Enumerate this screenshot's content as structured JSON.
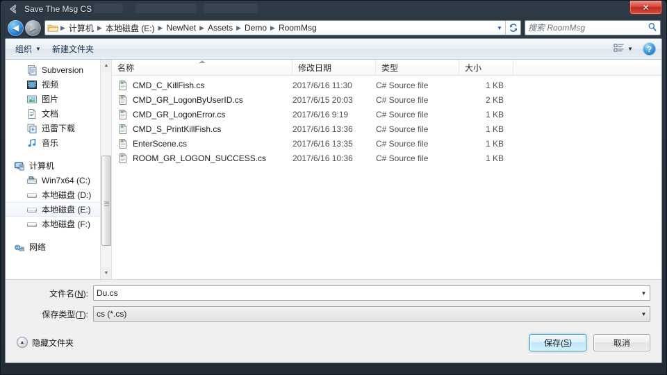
{
  "window": {
    "title": "Save The Msg CS",
    "title_icon": "unity-icon",
    "close_label": "✕"
  },
  "nav": {
    "back_icon": "back-arrow-icon",
    "forward_icon": "forward-arrow-icon",
    "folder_icon": "folder-icon",
    "dropdown_icon": "chevron-down-icon",
    "refresh_icon": "refresh-icon",
    "breadcrumbs": [
      "计算机",
      "本地磁盘 (E:)",
      "NewNet",
      "Assets",
      "Demo",
      "RoomMsg"
    ],
    "separator": "▶"
  },
  "search": {
    "placeholder": "搜索 RoomMsg",
    "value": "",
    "icon": "search-icon"
  },
  "toolbar": {
    "organize_label": "组织",
    "organize_caret": "▼",
    "new_folder_label": "新建文件夹",
    "view_icon": "view-list-icon",
    "view_caret": "▼",
    "help_label": "?",
    "help_icon": "help-icon"
  },
  "navpane": {
    "items": [
      {
        "label": "Subversion",
        "icon": "subversion-icon",
        "level": "indent",
        "selected": false
      },
      {
        "label": "视频",
        "icon": "video-icon",
        "level": "indent",
        "selected": false
      },
      {
        "label": "图片",
        "icon": "pictures-icon",
        "level": "indent",
        "selected": false
      },
      {
        "label": "文档",
        "icon": "documents-icon",
        "level": "indent",
        "selected": false
      },
      {
        "label": "迅雷下载",
        "icon": "thunder-download-icon",
        "level": "indent",
        "selected": false
      },
      {
        "label": "音乐",
        "icon": "music-icon",
        "level": "indent",
        "selected": false
      },
      {
        "label": "计算机",
        "icon": "computer-icon",
        "level": "root",
        "selected": false,
        "gap_before": true
      },
      {
        "label": "Win7x64 (C:)",
        "icon": "system-drive-icon",
        "level": "indent",
        "selected": false
      },
      {
        "label": "本地磁盘 (D:)",
        "icon": "drive-icon",
        "level": "indent",
        "selected": false
      },
      {
        "label": "本地磁盘 (E:)",
        "icon": "drive-icon",
        "level": "indent",
        "selected": true
      },
      {
        "label": "本地磁盘 (F:)",
        "icon": "drive-icon",
        "level": "indent",
        "selected": false
      },
      {
        "label": "网络",
        "icon": "network-icon",
        "level": "root",
        "selected": false,
        "gap_before": true
      }
    ],
    "scroll_up_icon": "scroll-up-icon",
    "scroll_down_icon": "scroll-down-icon"
  },
  "filelist": {
    "columns": [
      "名称",
      "修改日期",
      "类型",
      "大小"
    ],
    "sort_column": "名称",
    "rows": [
      {
        "name": "CMD_C_KillFish.cs",
        "date": "2017/6/16 11:30",
        "type": "C# Source file",
        "size": "1 KB",
        "icon": "csharp-file-icon"
      },
      {
        "name": "CMD_GR_LogonByUserID.cs",
        "date": "2017/6/15 20:03",
        "type": "C# Source file",
        "size": "2 KB",
        "icon": "csharp-file-icon"
      },
      {
        "name": "CMD_GR_LogonError.cs",
        "date": "2017/6/16 9:19",
        "type": "C# Source file",
        "size": "1 KB",
        "icon": "csharp-file-icon"
      },
      {
        "name": "CMD_S_PrintKillFish.cs",
        "date": "2017/6/16 13:36",
        "type": "C# Source file",
        "size": "1 KB",
        "icon": "csharp-file-icon"
      },
      {
        "name": "EnterScene.cs",
        "date": "2017/6/16 13:35",
        "type": "C# Source file",
        "size": "1 KB",
        "icon": "csharp-file-icon"
      },
      {
        "name": "ROOM_GR_LOGON_SUCCESS.cs",
        "date": "2017/6/16 10:36",
        "type": "C# Source file",
        "size": "1 KB",
        "icon": "csharp-file-icon"
      }
    ]
  },
  "form": {
    "filename_label_pre": "文件名(",
    "filename_label_key": "N",
    "filename_label_post": "):",
    "filename_value": "Du.cs",
    "filetype_label_pre": "保存类型(",
    "filetype_label_key": "T",
    "filetype_label_post": "):",
    "filetype_value": "cs (*.cs)",
    "dropdown_icon": "chevron-down-icon"
  },
  "footer": {
    "hide_folders_label": "隐藏文件夹",
    "hide_folders_icon": "chevron-up-circle-icon",
    "save_label_pre": "保存(",
    "save_label_key": "S",
    "save_label_post": ")",
    "cancel_label": "取消"
  },
  "colors": {
    "accent": "#3c9cd4",
    "close_red": "#d94a3d",
    "frame": "#28323e",
    "selection": "#eaf4fd"
  }
}
